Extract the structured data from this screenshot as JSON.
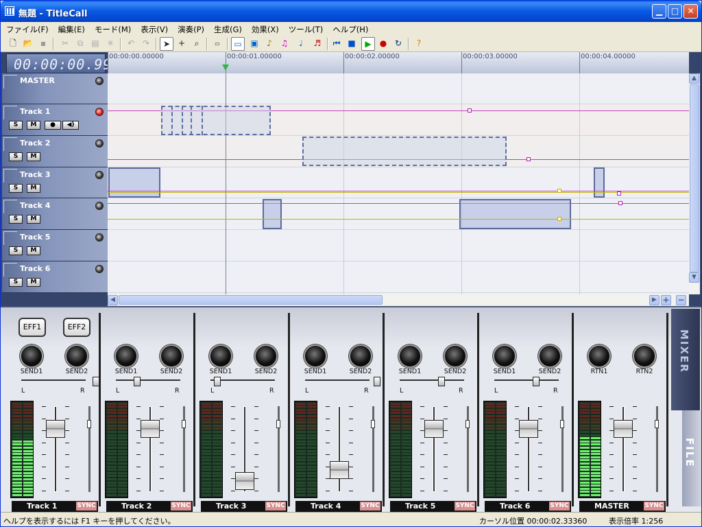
{
  "window": {
    "title": "無題 - TitleCall"
  },
  "menu": [
    "ファイル(F)",
    "編集(E)",
    "モード(M)",
    "表示(V)",
    "演奏(P)",
    "生成(G)",
    "効果(X)",
    "ツール(T)",
    "ヘルプ(H)"
  ],
  "transport": {
    "time": "00:00:00.99"
  },
  "ruler": {
    "labels": [
      "00:00:00.00000",
      "00:00:01.00000",
      "00:00:02.00000",
      "00:00:03.00000",
      "00:00:04.00000"
    ]
  },
  "track_buttons": {
    "solo": "S",
    "mute": "M"
  },
  "tracks": [
    {
      "name": "MASTER"
    },
    {
      "name": "Track 1"
    },
    {
      "name": "Track 2"
    },
    {
      "name": "Track 3"
    },
    {
      "name": "Track 4"
    },
    {
      "name": "Track 5"
    },
    {
      "name": "Track 6"
    }
  ],
  "mixer": {
    "eff1": "EFF1",
    "eff2": "EFF2",
    "send1": "SEND1",
    "send2": "SEND2",
    "rtn1": "RTN1",
    "rtn2": "RTN2",
    "pan_l": "L",
    "pan_r": "R",
    "sync": "SYNC",
    "tab_mixer": "MIXER",
    "tab_file": "FILE",
    "strips": [
      "Track 1",
      "Track 2",
      "Track 3",
      "Track 4",
      "Track 5",
      "Track 6",
      "MASTER"
    ]
  },
  "status": {
    "help": "ヘルプを表示するには F1 キーを押してください。",
    "cursor": "カーソル位置 00:00:02.33360",
    "zoom": "表示倍率 1:256"
  }
}
